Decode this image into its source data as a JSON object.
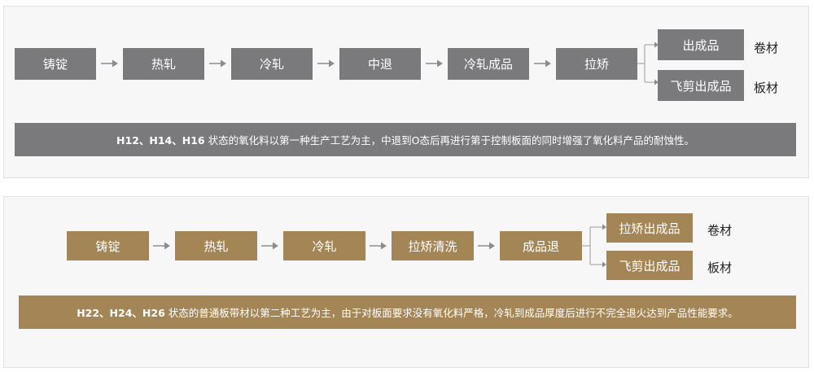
{
  "flow1": {
    "steps": [
      "铸锭",
      "热轧",
      "冷轧",
      "中退",
      "冷轧成品",
      "拉矫"
    ],
    "branches": [
      {
        "box": "出成品",
        "label": "卷材"
      },
      {
        "box": "飞剪出成品",
        "label": "板材"
      }
    ],
    "note_bold": "H12、H14、H16",
    "note_text": "状态的氧化料以第一种生产工艺为主，中退到O态后再进行第于控制板面的同时增强了氧化料产品的耐蚀性。"
  },
  "flow2": {
    "steps": [
      "铸锭",
      "热轧",
      "冷轧",
      "拉矫清洗",
      "成品退"
    ],
    "branches": [
      {
        "box": "拉矫出成品",
        "label": "卷材"
      },
      {
        "box": "飞剪出成品",
        "label": "板材"
      }
    ],
    "note_bold": "H22、H24、H26",
    "note_text": "状态的普通板带材以第二种工艺为主，由于对板面要求没有氧化料严格，冷轧到成品厚度后进行不完全退火达到产品性能要求。"
  },
  "colors": {
    "gray": "#7a7a7c",
    "brown": "#a48656",
    "arrow": "#8c8c8c"
  }
}
